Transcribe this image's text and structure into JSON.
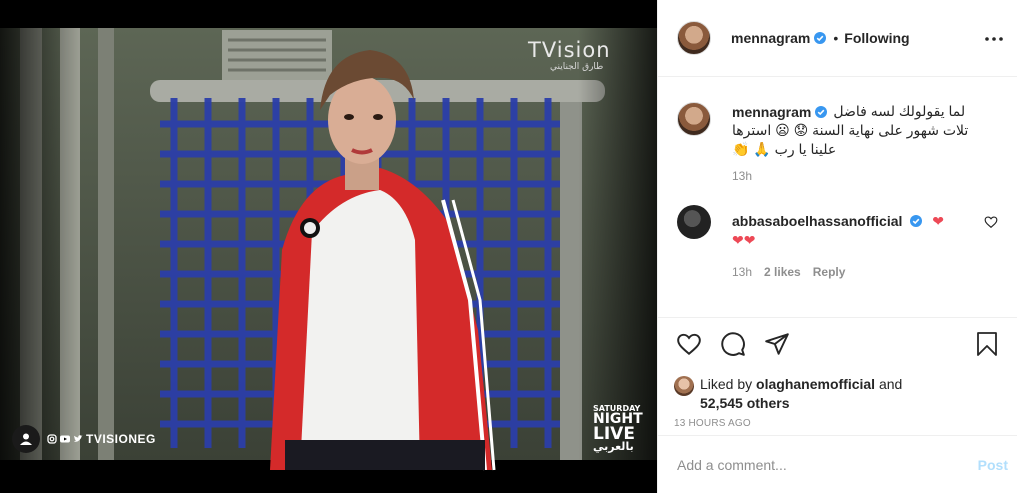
{
  "media": {
    "broadcaster_logo": "TVision",
    "broadcaster_logo_sub": "طارق الجنايني",
    "show_logo": [
      "SATURDAY",
      "NIGHT",
      "LIVE",
      "بالعربي"
    ],
    "watermark_handle": "TVISIONEG"
  },
  "header": {
    "username": "mennagram",
    "separator": "•",
    "follow_status": "Following",
    "more_icon": "more-horizontal-icon"
  },
  "caption": {
    "username": "mennagram",
    "text_line1": "لما يقولولك لسه فاضل",
    "text_line2": "تلات شهور على نهاية السنة 😟 😦 استرها",
    "text_line3": "علينا يا رب 🙏 👏",
    "time": "13h"
  },
  "reply": {
    "username": "abbasaboelhassanofficial",
    "hearts_inline": "❤",
    "hearts_line2": "❤❤",
    "time": "13h",
    "likes": "2 likes",
    "reply_label": "Reply"
  },
  "actions": {
    "liked_by_prefix": "Liked by",
    "liked_by_user": "olaghanemofficial",
    "liked_by_and": "and",
    "others_count": "52,545 others",
    "timestamp": "13 HOURS AGO"
  },
  "comment_box": {
    "placeholder": "Add a comment...",
    "post_label": "Post"
  },
  "colors": {
    "verified": "#3897f0",
    "heart": "#ed4956",
    "post_disabled": "#b2dffc",
    "secondary_text": "#8e8e8e"
  }
}
